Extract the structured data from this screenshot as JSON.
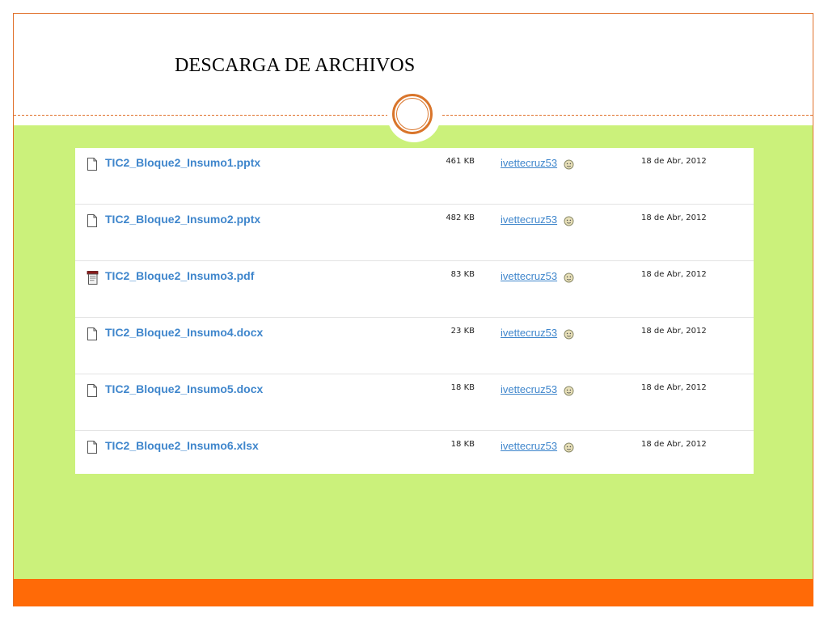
{
  "slide": {
    "title": "DESCARGA DE ARCHIVOS"
  },
  "colors": {
    "accent_orange": "#ff6a07",
    "band_green": "#cbf17b",
    "link_blue": "#3f86cc"
  },
  "files": [
    {
      "name": "TIC2_Bloque2_Insumo1.pptx",
      "size": "461 KB",
      "user": "ivettecruz53",
      "date": "18 de Abr, 2012",
      "icon": "document-icon"
    },
    {
      "name": "TIC2_Bloque2_Insumo2.pptx",
      "size": "482 KB",
      "user": "ivettecruz53",
      "date": "18 de Abr, 2012",
      "icon": "document-icon"
    },
    {
      "name": "TIC2_Bloque2_Insumo3.pdf",
      "size": "83 KB",
      "user": "ivettecruz53",
      "date": "18 de Abr, 2012",
      "icon": "pdf-icon"
    },
    {
      "name": "TIC2_Bloque2_Insumo4.docx",
      "size": "23 KB",
      "user": "ivettecruz53",
      "date": "18 de Abr, 2012",
      "icon": "document-icon"
    },
    {
      "name": "TIC2_Bloque2_Insumo5.docx",
      "size": "18 KB",
      "user": "ivettecruz53",
      "date": "18 de Abr, 2012",
      "icon": "document-icon"
    },
    {
      "name": "TIC2_Bloque2_Insumo6.xlsx",
      "size": "18 KB",
      "user": "ivettecruz53",
      "date": "18 de Abr, 2012",
      "icon": "document-icon"
    }
  ]
}
